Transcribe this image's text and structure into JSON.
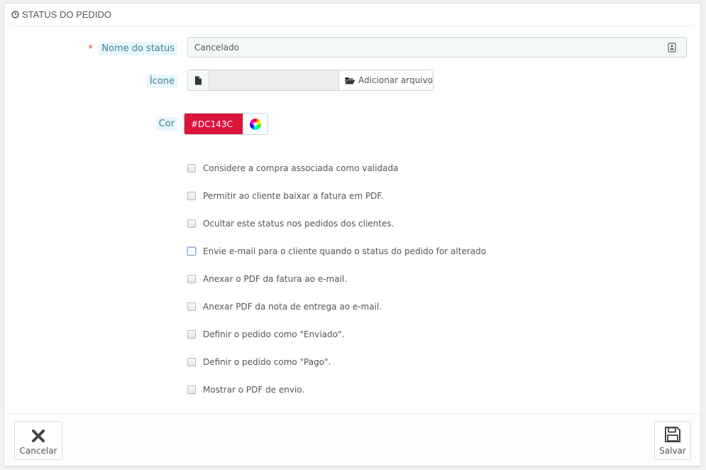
{
  "panel": {
    "title": "STATUS DO PEDIDO"
  },
  "form": {
    "name_label": "Nome do status",
    "required_mark": "*",
    "name_value": "Cancelado",
    "icon_label": "Ícone",
    "add_file_label": "Adicionar arquivo",
    "color_label": "Cor",
    "color_value": "#DC143C",
    "color_hex": "#DC143C"
  },
  "checkboxes": [
    {
      "label": "Considere a compra associada como validada",
      "checked": false
    },
    {
      "label": "Permitir ao cliente baixar a fatura em PDF.",
      "checked": false
    },
    {
      "label": "Ocultar este status nos pedidos dos clientes.",
      "checked": false
    },
    {
      "label": "Envie e-mail para o cliente quando o status do pedido for alterado",
      "checked": false,
      "focused": true
    },
    {
      "label": "Anexar o PDF da fatura ao e-mail.",
      "checked": false
    },
    {
      "label": "Anexar PDF da nota de entrega ao e-mail.",
      "checked": false
    },
    {
      "label": "Definir o pedido como \"Enviado\".",
      "checked": false
    },
    {
      "label": "Definir o pedido como \"Pago\".",
      "checked": false
    },
    {
      "label": "Mostrar o PDF de envio.",
      "checked": false
    }
  ],
  "footer": {
    "cancel_label": "Cancelar",
    "save_label": "Salvar"
  },
  "icons": {
    "heading": "clock-icon",
    "name_field": "contact-card-icon",
    "file": "file-icon",
    "folder": "folder-open-icon",
    "color_picker": "color-wheel-icon",
    "cancel": "close-icon",
    "save": "floppy-disk-icon"
  }
}
